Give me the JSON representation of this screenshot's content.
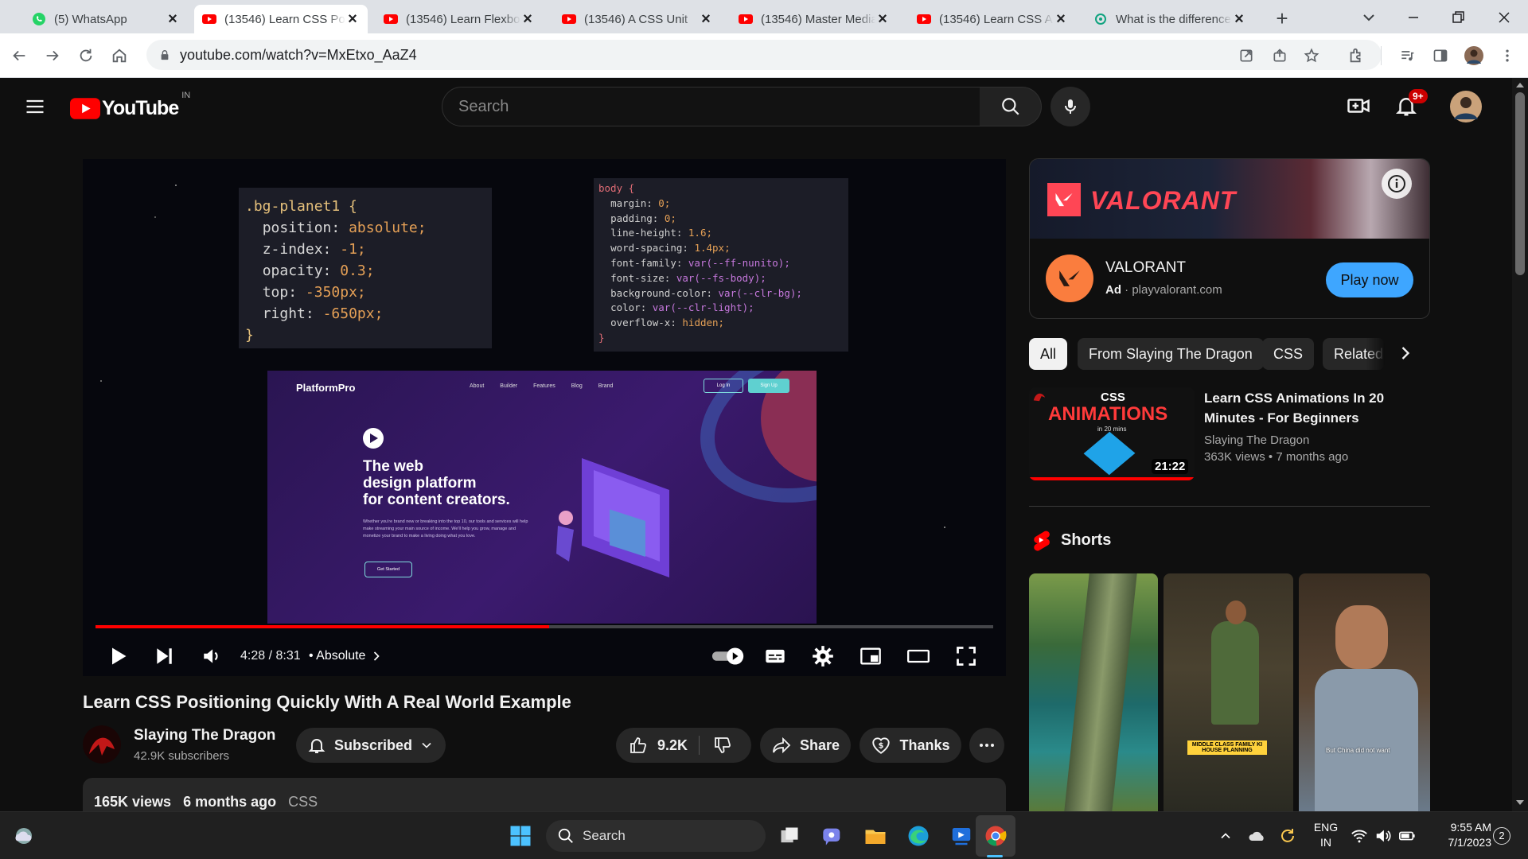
{
  "browser": {
    "tabs": [
      {
        "title": "(5) WhatsApp",
        "icon": "whatsapp-icon",
        "active": false
      },
      {
        "title": "(13546) Learn CSS Positioning",
        "icon": "youtube-icon",
        "active": true
      },
      {
        "title": "(13546) Learn Flexbox",
        "icon": "youtube-icon",
        "active": false
      },
      {
        "title": "(13546) A CSS Unit",
        "icon": "youtube-icon",
        "active": false
      },
      {
        "title": "(13546) Master Media",
        "icon": "youtube-icon",
        "active": false
      },
      {
        "title": "(13546) Learn CSS A",
        "icon": "youtube-icon",
        "active": false
      },
      {
        "title": "What is the difference",
        "icon": "chatgpt-icon",
        "active": false
      }
    ],
    "url": "youtube.com/watch?v=MxEtxo_AaZ4"
  },
  "youtube": {
    "logo_text": "YouTube",
    "country": "IN",
    "search_placeholder": "Search",
    "notif_badge": "9+"
  },
  "player": {
    "code_left": {
      "selector": ".bg-planet1 {",
      "lines": [
        {
          "prop": "position:",
          "val": "absolute;"
        },
        {
          "prop": "z-index:",
          "val": "-1;"
        },
        {
          "prop": "opacity:",
          "val": "0.3;"
        },
        {
          "prop": "top:",
          "val": "-350px;"
        },
        {
          "prop": "right:",
          "val": "-650px;"
        }
      ],
      "close": "}"
    },
    "code_right": {
      "selector": "body {",
      "lines": [
        {
          "prop": "margin:",
          "val": "0;"
        },
        {
          "prop": "padding:",
          "val": "0;"
        },
        {
          "prop": "line-height:",
          "val": "1.6;"
        },
        {
          "prop": "word-spacing:",
          "val": "1.4px;"
        },
        {
          "prop": "font-family:",
          "val": "var(--ff-nunito);"
        },
        {
          "prop": "font-size:",
          "val": "var(--fs-body);"
        },
        {
          "prop": "background-color:",
          "val": "var(--clr-bg);"
        },
        {
          "prop": "color:",
          "val": "var(--clr-light);"
        },
        {
          "prop": "overflow-x:",
          "val": "hidden;"
        }
      ],
      "close": "}"
    },
    "demo": {
      "brand": "PlatformPro",
      "nav": [
        "About",
        "Builder",
        "Features",
        "Blog",
        "Brand"
      ],
      "login": "Log In",
      "signup": "Sign Up",
      "headline": [
        "The web",
        "design platform",
        "for content creators."
      ],
      "body": "Whether you're brand new or breaking into the top 10, our tools and services will help make streaming your main source of income. We'll help you grow, manage and monetize your brand to make a living doing what you love.",
      "cta": "Get Started"
    },
    "progress_fraction": 0.505,
    "time": "4:28 / 8:31",
    "chapter": "• Absolute"
  },
  "video": {
    "title": "Learn CSS Positioning Quickly With A Real World Example",
    "channel": "Slaying The Dragon",
    "subscribers": "42.9K subscribers",
    "subscribed_label": "Subscribed",
    "likes": "9.2K",
    "share_label": "Share",
    "thanks_label": "Thanks",
    "views": "165K views",
    "age": "6 months ago",
    "tag": "CSS"
  },
  "ad": {
    "banner_text": "VALORANT",
    "name": "VALORANT",
    "ad_label": "Ad",
    "site": "playvalorant.com",
    "cta": "Play now"
  },
  "chips": [
    "All",
    "From Slaying The Dragon",
    "CSS",
    "Related"
  ],
  "recommended": [
    {
      "thumb_line1": "CSS",
      "thumb_line2": "ANIMATIONS",
      "thumb_line3": "in 20 mins",
      "duration": "21:22",
      "watched_fraction": 1.0,
      "title": "Learn CSS Animations In 20 Minutes - For Beginners",
      "channel": "Slaying The Dragon",
      "views": "363K views",
      "age": "7 months ago"
    }
  ],
  "shorts": {
    "heading": "Shorts",
    "items": [
      {
        "caption": ""
      },
      {
        "caption": "MIDDLE CLASS FAMILY KI HOUSE PLANNING"
      },
      {
        "caption": "But China did not want"
      }
    ]
  },
  "taskbar": {
    "search_label": "Search",
    "lang": "ENG",
    "region": "IN",
    "time": "9:55 AM",
    "date": "7/1/2023",
    "notif_count": "2"
  },
  "colors": {
    "yt_red": "#ff0000",
    "play_now_blue": "#3ea6ff",
    "valorant_red": "#ff4655"
  }
}
